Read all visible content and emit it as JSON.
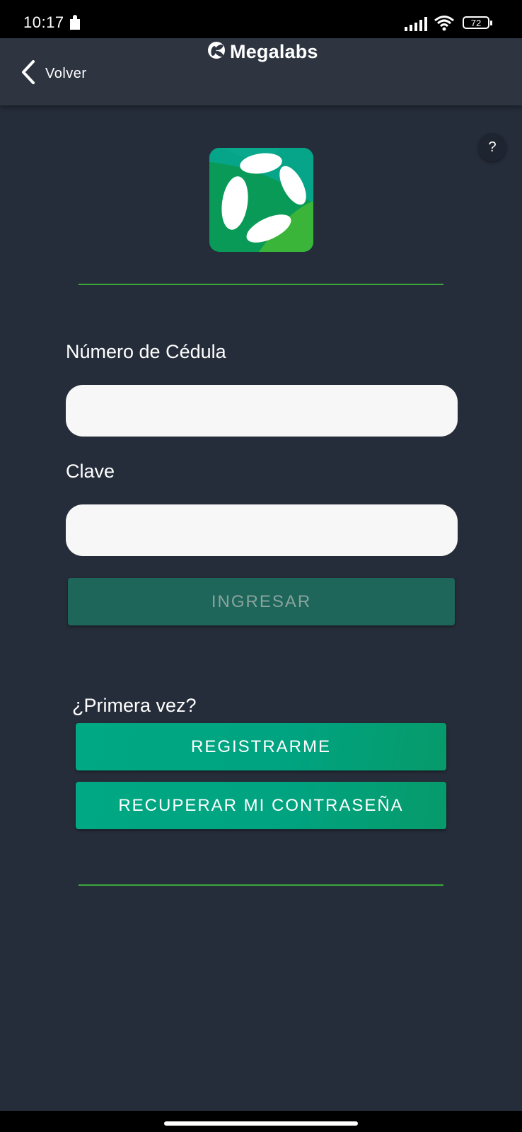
{
  "status_bar": {
    "time": "10:17",
    "battery": "72",
    "icons": [
      "app-notification-icon",
      "signal-icon",
      "wifi-icon",
      "battery-icon"
    ]
  },
  "header": {
    "back_label": "Volver",
    "brand_name": "Megalabs",
    "icons": [
      "back-chevron-icon",
      "megalabs-logo-icon"
    ]
  },
  "help": {
    "label": "?"
  },
  "form": {
    "id_label": "Número de Cédula",
    "id_value": "",
    "password_label": "Clave",
    "password_value": "",
    "login_label": "INGRESAR"
  },
  "first_time": {
    "prompt": "¿Primera vez?",
    "register_label": "REGISTRARME",
    "recover_label": "RECUPERAR MI CONTRASEÑA"
  },
  "colors": {
    "background": "#262d3a",
    "appbar": "#2e3541",
    "accent_green": "#00a884",
    "divider_green": "#3aa83a",
    "login_disabled": "#1e6659"
  }
}
